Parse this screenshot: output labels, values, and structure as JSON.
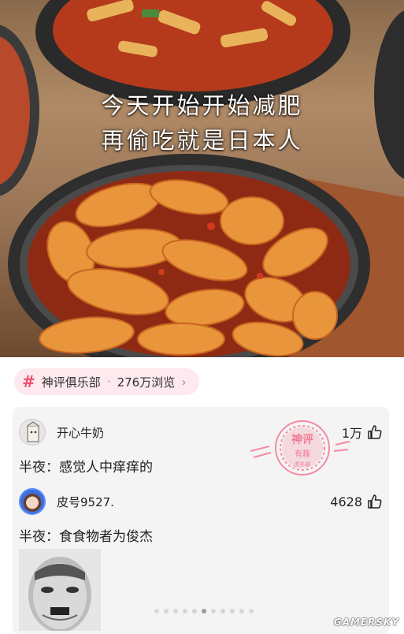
{
  "photo": {
    "caption_line1": "今天开始开始减肥",
    "caption_line2": "再偷吃就是日本人"
  },
  "topic": {
    "icon": "hash-icon",
    "name": "神评俱乐部",
    "separator": "·",
    "views": "276万浏览",
    "chevron": "›",
    "accent": "#f0506e"
  },
  "comments": [
    {
      "username": "开心牛奶",
      "likes": "1万",
      "text": "半夜：感觉人中痒痒的"
    },
    {
      "username": "皮号9527.",
      "likes": "4628",
      "text": "半夜：食食物者为俊杰"
    }
  ],
  "stamp": {
    "line1": "神评",
    "line2": "有趣",
    "line3": "虎扑部",
    "color": "#f48aa0"
  },
  "pager": {
    "count": 11,
    "active": 5
  },
  "watermark": "GAMERSKY"
}
